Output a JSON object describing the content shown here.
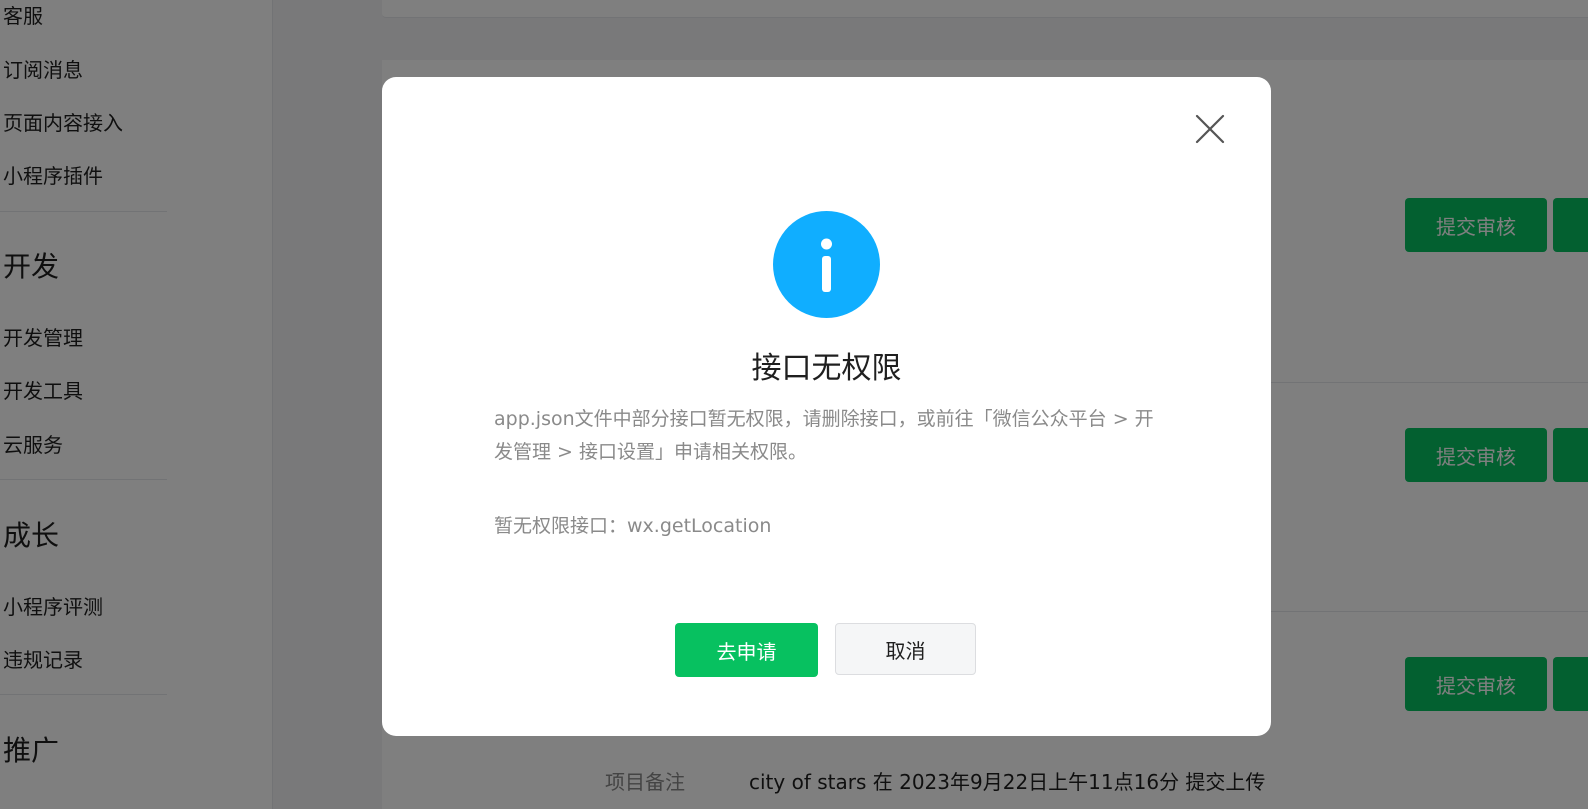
{
  "sidebar": {
    "items_top": [
      "客服",
      "订阅消息",
      "页面内容接入",
      "小程序插件"
    ],
    "section_dev": "开发",
    "items_dev": [
      "开发管理",
      "开发工具",
      "云服务"
    ],
    "section_growth": "成长",
    "items_growth": [
      "小程序评测",
      "违规记录"
    ],
    "section_promo": "推广"
  },
  "main": {
    "submit_label": "提交审核",
    "remark_label": "项目备注",
    "remark_value": "city of stars 在 2023年9月22日上午11点16分 提交上传"
  },
  "dialog": {
    "title": "接口无权限",
    "description": "app.json文件中部分接口暂无权限，请删除接口，或前往「微信公众平台 > 开发管理 > 接口设置」申请相关权限。",
    "api_text": "暂无权限接口：wx.getLocation",
    "apply_label": "去申请",
    "cancel_label": "取消",
    "icon": "info-icon",
    "close_icon": "close-icon"
  },
  "colors": {
    "primary": "#07c160",
    "info": "#10aeff"
  }
}
